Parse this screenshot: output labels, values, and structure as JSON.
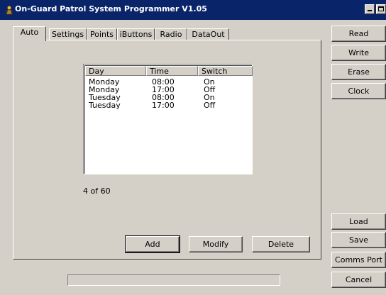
{
  "window": {
    "title": "On-Guard Patrol System Programmer V1.05",
    "icon": "app-icon"
  },
  "tabs": [
    {
      "label": "Auto",
      "active": true
    },
    {
      "label": "Settings",
      "active": false
    },
    {
      "label": "Points",
      "active": false
    },
    {
      "label": "iButtons",
      "active": false
    },
    {
      "label": "Radio",
      "active": false
    },
    {
      "label": "DataOut",
      "active": false
    }
  ],
  "schedule": {
    "columns": [
      "Day",
      "Time",
      "Switch"
    ],
    "rows": [
      [
        "Monday",
        "08:00",
        "On"
      ],
      [
        "Monday",
        "17:00",
        "Off"
      ],
      [
        "Tuesday",
        "08:00",
        "On"
      ],
      [
        "Tuesday",
        "17:00",
        "Off"
      ]
    ],
    "count_text": "4 of 60"
  },
  "panel_buttons": {
    "add": "Add",
    "modify": "Modify",
    "delete": "Delete"
  },
  "side_buttons": {
    "read": "Read",
    "write": "Write",
    "erase": "Erase",
    "clock": "Clock",
    "load": "Load",
    "save": "Save",
    "comms_port": "Comms Port",
    "cancel": "Cancel"
  }
}
